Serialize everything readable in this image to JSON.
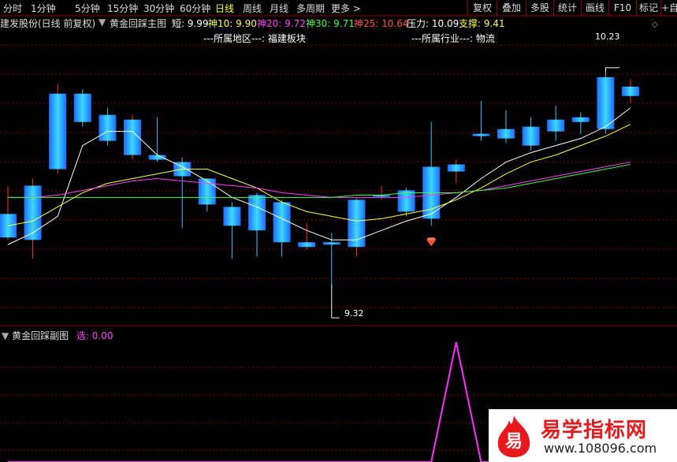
{
  "toolbar": {
    "periods": [
      "分时",
      "1分钟",
      "5分钟",
      "15分钟",
      "30分钟",
      "60分钟",
      "日线",
      "周线",
      "月线",
      "多周期",
      "更多 >"
    ],
    "active_period": "日线",
    "buttons": [
      "复权",
      "叠加",
      "多股",
      "统计",
      "画线",
      "F10",
      "标记",
      "+自"
    ]
  },
  "info": {
    "stock": "建发股份(日线 前复权)",
    "indicator": "黄金回踩主图",
    "short_label": "短: 9.99",
    "s10": "神10: 9.90",
    "s20": "神20: 9.72",
    "s30": "神30: 9.71",
    "s25": "神25: 10.64",
    "pressure": "压力: 10.09",
    "support": "支撑: 9.41"
  },
  "region": {
    "area": "---所属地区---:  福建板块",
    "industry": "---所属行业---:  物流"
  },
  "annotations": {
    "high": "10.23",
    "low": "9.32"
  },
  "sub": {
    "title": "黄金回踩副图",
    "select": "选: 0.00"
  },
  "colors": {
    "up": "#00c0ff",
    "down": "#00a0f0",
    "wick_up": "#ff3030",
    "grid": "#8b0000",
    "ma_white": "#ffffff",
    "ma_yellow": "#ffff40",
    "ma_magenta": "#ff40ff",
    "ma_green": "#40ff40"
  },
  "logo": {
    "text": "易学指标网",
    "url": "www.108096.com",
    "mark": "易"
  },
  "chart_data": {
    "type": "candlestick",
    "candles": [
      {
        "o": 9.53,
        "c": 9.63,
        "h": 9.75,
        "l": 9.52
      },
      {
        "o": 9.52,
        "c": 9.75,
        "h": 9.78,
        "l": 9.44
      },
      {
        "o": 9.82,
        "c": 10.14,
        "h": 10.18,
        "l": 9.8
      },
      {
        "o": 10.14,
        "c": 10.02,
        "h": 10.16,
        "l": 10.0
      },
      {
        "o": 10.05,
        "c": 9.94,
        "h": 10.08,
        "l": 9.92
      },
      {
        "o": 9.88,
        "c": 10.03,
        "h": 10.05,
        "l": 9.86
      },
      {
        "o": 9.88,
        "c": 9.86,
        "h": 10.04,
        "l": 9.85
      },
      {
        "o": 9.85,
        "c": 9.79,
        "h": 9.87,
        "l": 9.57
      },
      {
        "o": 9.78,
        "c": 9.67,
        "h": 9.78,
        "l": 9.64
      },
      {
        "o": 9.66,
        "c": 9.58,
        "h": 9.68,
        "l": 9.44
      },
      {
        "o": 9.71,
        "c": 9.56,
        "h": 9.72,
        "l": 9.45
      },
      {
        "o": 9.68,
        "c": 9.51,
        "h": 9.69,
        "l": 9.45
      },
      {
        "o": 9.49,
        "c": 9.51,
        "h": 9.59,
        "l": 9.48
      },
      {
        "o": 9.51,
        "c": 9.5,
        "h": 9.55,
        "l": 9.33
      },
      {
        "o": 9.49,
        "c": 9.69,
        "h": 9.7,
        "l": 9.45
      },
      {
        "o": 9.71,
        "c": 9.71,
        "h": 9.75,
        "l": 9.69
      },
      {
        "o": 9.73,
        "c": 9.64,
        "h": 9.74,
        "l": 9.62
      },
      {
        "o": 9.83,
        "c": 9.61,
        "h": 10.02,
        "l": 9.58
      },
      {
        "o": 9.81,
        "c": 9.84,
        "h": 9.86,
        "l": 9.76
      },
      {
        "o": 9.97,
        "c": 9.96,
        "h": 10.11,
        "l": 9.94
      },
      {
        "o": 9.99,
        "c": 9.95,
        "h": 10.07,
        "l": 9.93
      },
      {
        "o": 10.0,
        "c": 9.92,
        "h": 10.04,
        "l": 9.9
      },
      {
        "o": 10.03,
        "c": 9.98,
        "h": 10.09,
        "l": 9.94
      },
      {
        "o": 10.04,
        "c": 10.02,
        "h": 10.06,
        "l": 9.97
      },
      {
        "o": 10.21,
        "c": 9.99,
        "h": 10.23,
        "l": 9.97
      },
      {
        "o": 10.13,
        "c": 10.17,
        "h": 10.2,
        "l": 10.1
      }
    ],
    "ma_white": [
      9.5,
      9.55,
      9.62,
      9.92,
      9.98,
      9.98,
      9.88,
      9.83,
      9.77,
      9.7,
      9.66,
      9.61,
      9.56,
      9.52,
      9.52,
      9.56,
      9.6,
      9.63,
      9.7,
      9.78,
      9.85,
      9.89,
      9.92,
      9.95,
      10.0,
      10.08
    ],
    "ma_yellow": [
      9.58,
      9.6,
      9.66,
      9.72,
      9.76,
      9.78,
      9.8,
      9.82,
      9.82,
      9.78,
      9.74,
      9.68,
      9.64,
      9.62,
      9.6,
      9.61,
      9.63,
      9.65,
      9.69,
      9.74,
      9.8,
      9.85,
      9.88,
      9.92,
      9.96,
      10.01
    ],
    "ma_magenta": [
      9.7,
      9.7,
      9.71,
      9.73,
      9.75,
      9.77,
      9.78,
      9.77,
      9.76,
      9.75,
      9.74,
      9.72,
      9.71,
      9.7,
      9.7,
      9.7,
      9.7,
      9.71,
      9.72,
      9.73,
      9.75,
      9.77,
      9.79,
      9.81,
      9.83,
      9.85
    ],
    "ma_green": [
      9.7,
      9.7,
      9.7,
      9.7,
      9.7,
      9.7,
      9.7,
      9.7,
      9.7,
      9.7,
      9.7,
      9.7,
      9.7,
      9.7,
      9.71,
      9.71,
      9.72,
      9.72,
      9.72,
      9.73,
      9.74,
      9.76,
      9.78,
      9.8,
      9.82,
      9.84
    ],
    "signal_index": 17,
    "sub_series": [
      0,
      0,
      0,
      0,
      0,
      0,
      0,
      0,
      0,
      0,
      0,
      0,
      0,
      0,
      0,
      0,
      0,
      0,
      1,
      0,
      0,
      0,
      0,
      0,
      0,
      0
    ],
    "ylim": [
      9.2,
      10.35
    ]
  }
}
